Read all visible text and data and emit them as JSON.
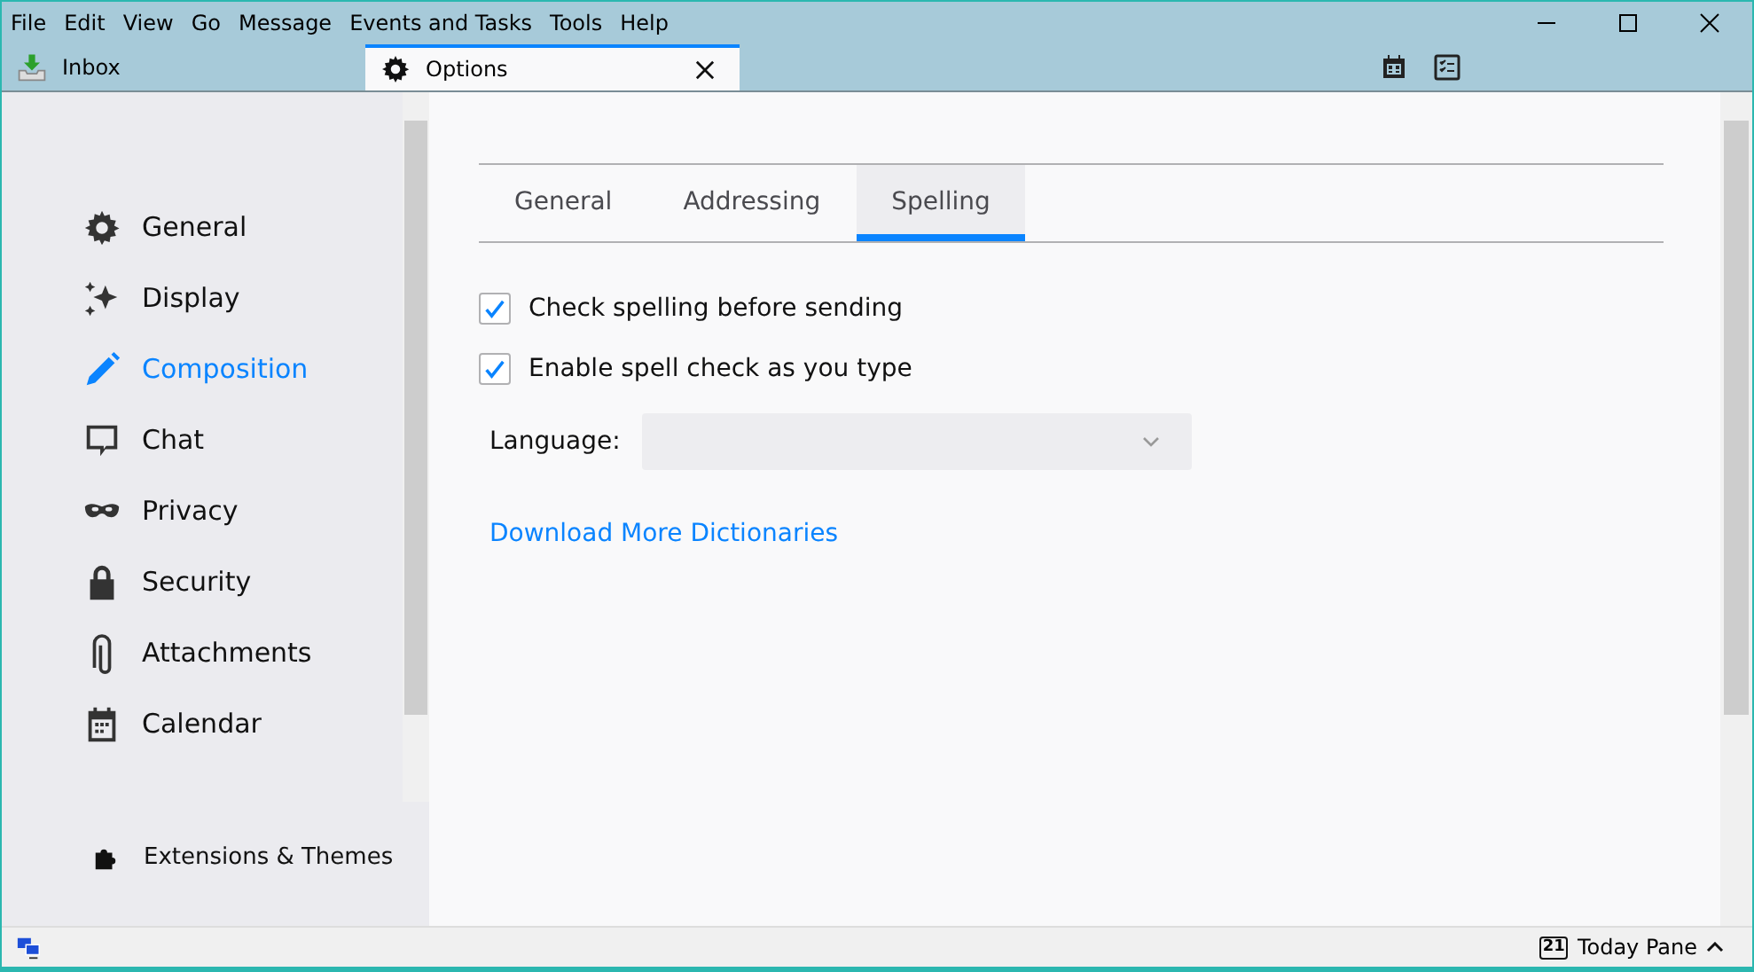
{
  "menu_bar": [
    "File",
    "Edit",
    "View",
    "Go",
    "Message",
    "Events and Tasks",
    "Tools",
    "Help"
  ],
  "tabs": [
    {
      "label": "Inbox",
      "selected": false
    },
    {
      "label": "Options",
      "selected": true
    }
  ],
  "sidebar": {
    "items": [
      {
        "label": "General",
        "selected": false
      },
      {
        "label": "Display",
        "selected": false
      },
      {
        "label": "Composition",
        "selected": true
      },
      {
        "label": "Chat",
        "selected": false
      },
      {
        "label": "Privacy",
        "selected": false
      },
      {
        "label": "Security",
        "selected": false
      },
      {
        "label": "Attachments",
        "selected": false
      },
      {
        "label": "Calendar",
        "selected": false
      }
    ],
    "footer": "Extensions & Themes"
  },
  "pane_tabs": [
    {
      "label": "General",
      "selected": false
    },
    {
      "label": "Addressing",
      "selected": false
    },
    {
      "label": "Spelling",
      "selected": true
    }
  ],
  "options": [
    {
      "label": "Check spelling before sending",
      "checked": true
    },
    {
      "label": "Enable spell check as you type",
      "checked": true
    }
  ],
  "language": {
    "label": "Language:"
  },
  "link": "Download More Dictionaries",
  "status_bar": {
    "today_pane": "Today Pane",
    "today_number": "21"
  }
}
